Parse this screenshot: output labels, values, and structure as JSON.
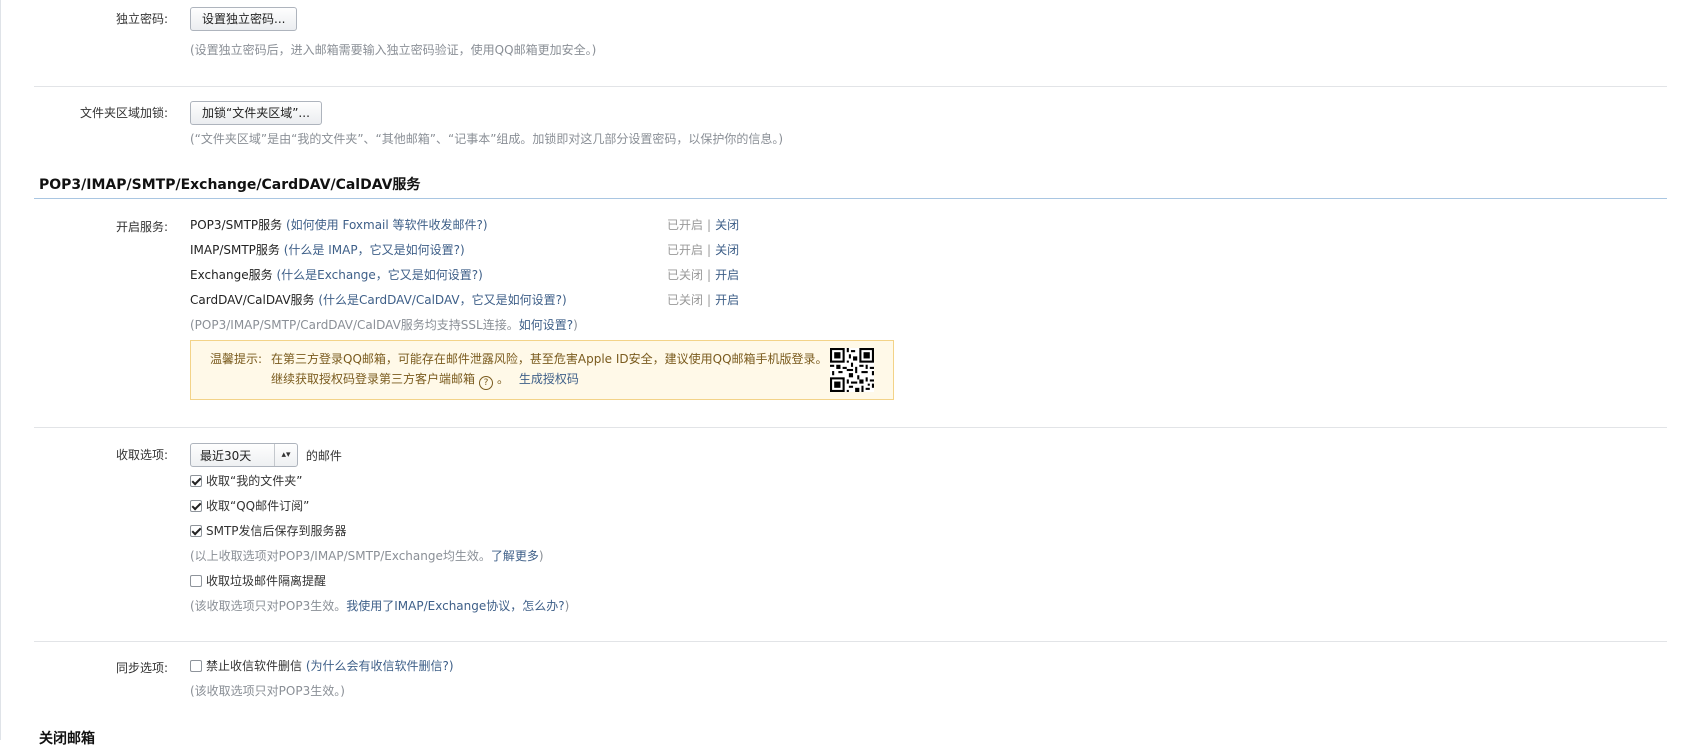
{
  "independent_password": {
    "label": "独立密码:",
    "button": "设置独立密码...",
    "hint": "(设置独立密码后，进入邮箱需要输入独立密码验证，使用QQ邮箱更加安全。)"
  },
  "folder_lock": {
    "label": "文件夹区域加锁:",
    "button": "加锁“文件夹区域”...",
    "hint": "(“文件夹区域”是由“我的文件夹”、“其他邮箱”、“记事本”组成。加锁即对这几部分设置密码，以保护你的信息。)"
  },
  "section": {
    "title": "POP3/IMAP/SMTP/Exchange/CardDAV/CalDAV服务"
  },
  "services": {
    "label": "开启服务:",
    "rows": [
      {
        "name": "POP3/SMTP服务",
        "link": "(如何使用 Foxmail 等软件收发邮件?)",
        "status": "已开启",
        "sep": "|",
        "action": "关闭"
      },
      {
        "name": "IMAP/SMTP服务",
        "link": "(什么是 IMAP，它又是如何设置?)",
        "status": "已开启",
        "sep": "|",
        "action": "关闭"
      },
      {
        "name": "Exchange服务",
        "link": "(什么是Exchange，它又是如何设置?)",
        "status": "已关闭",
        "sep": "|",
        "action": "开启"
      },
      {
        "name": "CardDAV/CalDAV服务",
        "link": "(什么是CardDAV/CalDAV，它又是如何设置?)",
        "status": "已关闭",
        "sep": "|",
        "action": "开启"
      }
    ],
    "ssl_hint": "(POP3/IMAP/SMTP/CardDAV/CalDAV服务均支持SSL连接。",
    "ssl_link": "如何设置?",
    "ssl_hint_end": ")"
  },
  "tip": {
    "label": "温馨提示:",
    "line1": "在第三方登录QQ邮箱，可能存在邮件泄露风险，甚至危害Apple ID安全，建议使用QQ邮箱手机版登录。",
    "line2_prefix": "继续获取授权码登录第三方客户端邮箱",
    "help_icon": "question-circle-icon",
    "line2_mid": "。",
    "line2_link": "生成授权码",
    "qr_icon": "qr-code-icon"
  },
  "receive": {
    "label": "收取选项:",
    "select_value": "最近30天",
    "select_suffix": "的邮件",
    "options": [
      {
        "label": "收取“我的文件夹”",
        "checked": true
      },
      {
        "label": "收取“QQ邮件订阅”",
        "checked": true
      },
      {
        "label": "SMTP发信后保存到服务器",
        "checked": true
      }
    ],
    "hint1": "(以上收取选项对POP3/IMAP/SMTP/Exchange均生效。",
    "hint1_link": "了解更多",
    "hint1_end": ")",
    "spam_option": {
      "label": "收取垃圾邮件隔离提醒",
      "checked": false
    },
    "hint2": "(该收取选项只对POP3生效。",
    "hint2_link": "我使用了IMAP/Exchange协议，怎么办?",
    "hint2_end": ")"
  },
  "sync": {
    "label": "同步选项:",
    "option": {
      "label": "禁止收信软件删信",
      "checked": false
    },
    "option_link": "(为什么会有收信软件删信?)",
    "hint": "(该收取选项只对POP3生效。)"
  },
  "next_section": {
    "title": "关闭邮箱"
  }
}
